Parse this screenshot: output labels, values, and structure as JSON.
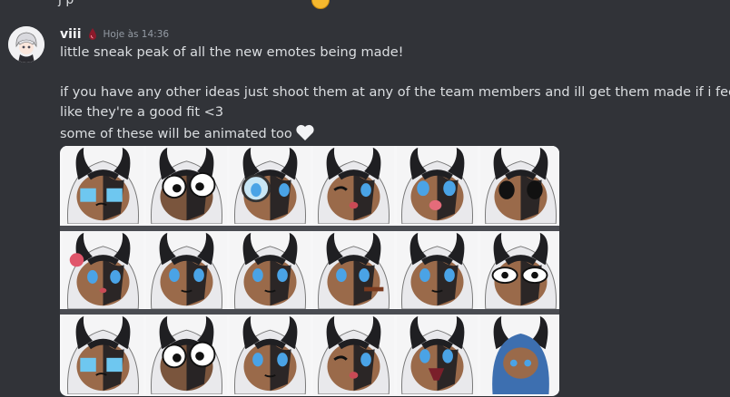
{
  "previous_message": {
    "text": "j                                                    p"
  },
  "message": {
    "username": "viii",
    "timestamp": "Hoje às 14:36",
    "lines": [
      "little sneak peak of all the new emotes being made!",
      "",
      "if you have any other ideas just shoot them at any of the team members and ill get them made if i feel",
      "like they're a good fit <3",
      "some of these will be animated too"
    ]
  },
  "colors": {
    "background": "#313338",
    "text": "#dbdee1",
    "timestamp": "#949ba4",
    "role_icon": "#8b1a2b",
    "emote_skin": "#9a6a4a",
    "emote_horn": "#1f1f22",
    "emote_eye": "#4aa3e6"
  },
  "emotes": [
    {
      "icon": "crying-emote-icon",
      "eyes": "crying"
    },
    {
      "icon": "googly-eyes-emote-icon",
      "eyes": "googly"
    },
    {
      "icon": "magnifier-emote-icon",
      "eyes": "magnifier"
    },
    {
      "icon": "wink-emote-icon",
      "eyes": "wink"
    },
    {
      "icon": "tongue-emote-icon",
      "eyes": "tongue"
    },
    {
      "icon": "blank-stare-emote-icon",
      "eyes": "dark"
    },
    {
      "icon": "rose-emote-icon",
      "eyes": "rose"
    },
    {
      "icon": "peek-emote-icon",
      "eyes": "normal"
    },
    {
      "icon": "gun-emote-icon",
      "eyes": "normal"
    },
    {
      "icon": "cigar-emote-icon",
      "eyes": "closed"
    },
    {
      "icon": "cigar-2-emote-icon",
      "eyes": "normal"
    },
    {
      "icon": "sweat-emote-icon",
      "eyes": "wide"
    },
    {
      "icon": "crying-2-emote-icon",
      "eyes": "crying"
    },
    {
      "icon": "googly-eyes-2-emote-icon",
      "eyes": "googly"
    },
    {
      "icon": "smirk-emote-icon",
      "eyes": "normal"
    },
    {
      "icon": "dual-guns-emote-icon",
      "eyes": "wink"
    },
    {
      "icon": "shout-emote-icon",
      "eyes": "shout"
    },
    {
      "icon": "blanket-emote-icon",
      "eyes": "blanket"
    }
  ]
}
